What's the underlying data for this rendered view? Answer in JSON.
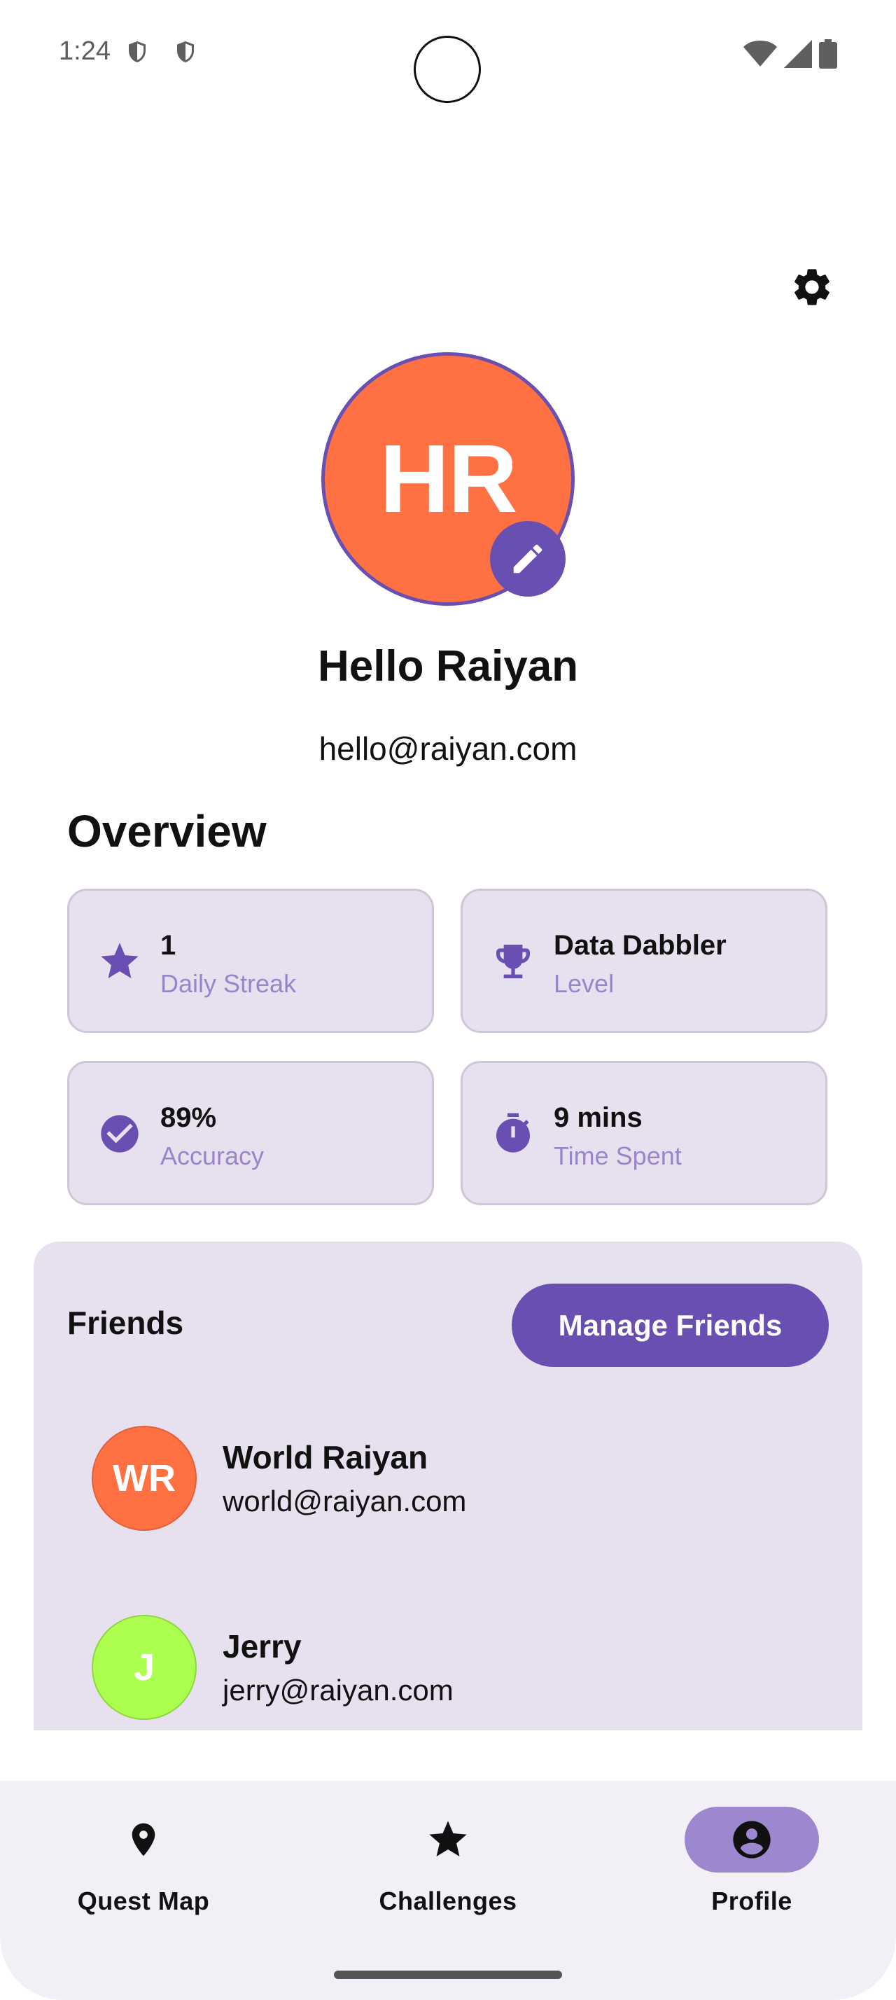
{
  "status_bar": {
    "time": "1:24"
  },
  "profile": {
    "initials": "HR",
    "greeting": "Hello Raiyan",
    "email": "hello@raiyan.com"
  },
  "overview": {
    "title": "Overview",
    "stats": [
      {
        "value": "1",
        "label": "Daily Streak",
        "icon": "star-icon"
      },
      {
        "value": "Data Dabbler",
        "label": "Level",
        "icon": "trophy-icon"
      },
      {
        "value": "89%",
        "label": "Accuracy",
        "icon": "check-circle-icon"
      },
      {
        "value": "9 mins",
        "label": "Time Spent",
        "icon": "timer-icon"
      }
    ]
  },
  "friends": {
    "title": "Friends",
    "manage_label": "Manage Friends",
    "list": [
      {
        "initials": "WR",
        "name": "World Raiyan",
        "email": "world@raiyan.com",
        "color": "#ff7043"
      },
      {
        "initials": "J",
        "name": "Jerry",
        "email": "jerry@raiyan.com",
        "color": "#adff4f"
      }
    ]
  },
  "nav": {
    "items": [
      {
        "label": "Quest Map",
        "icon": "location-pin-icon",
        "active": false
      },
      {
        "label": "Challenges",
        "icon": "star-icon",
        "active": false
      },
      {
        "label": "Profile",
        "icon": "account-circle-icon",
        "active": true
      }
    ]
  },
  "colors": {
    "accent": "#6a4fb3",
    "avatar_bg": "#ff7043",
    "card_bg": "#e7e0ef",
    "nav_active_pill": "#9d87cf"
  }
}
